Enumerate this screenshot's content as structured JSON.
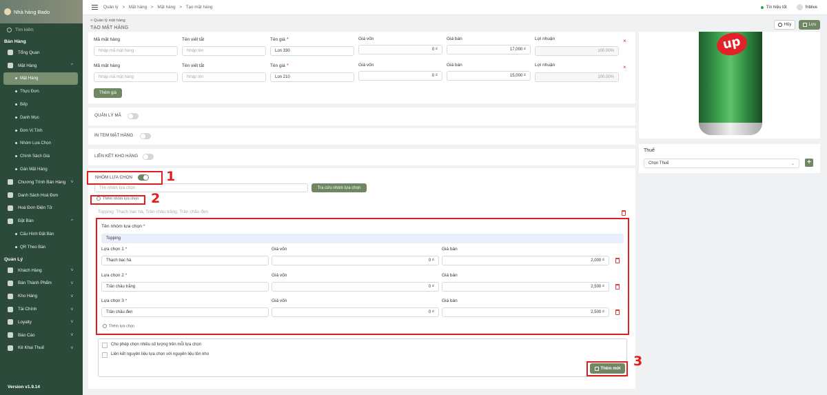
{
  "sidebar": {
    "brand": "Nhà hàng Bado",
    "search_placeholder": "Tìm kiếm",
    "section_sales": "Bán Hàng",
    "items_sales": [
      {
        "label": "Tổng Quan",
        "chev": ""
      },
      {
        "label": "Mặt Hàng",
        "chev": "^"
      }
    ],
    "sub_mathang": [
      "Mặt Hàng",
      "Thực Đơn",
      "Bếp",
      "Danh Mục",
      "Đơn Vị Tính",
      "Nhóm Lựa Chọn",
      "Chính Sách Giá",
      "Gán Mặt Hàng"
    ],
    "items_sales2": [
      {
        "label": "Chương Trình Bán Hàng",
        "chev": "v"
      },
      {
        "label": "Danh Sách Hoá Đơn",
        "chev": ""
      },
      {
        "label": "Hoá Đơn Điện Tử",
        "chev": ""
      },
      {
        "label": "Đặt Bàn",
        "chev": "^"
      }
    ],
    "sub_datban": [
      "Cấu Hình Đặt Bàn",
      "QR Theo Bàn"
    ],
    "section_manage": "Quản Lý",
    "items_manage": [
      {
        "label": "Khách Hàng",
        "chev": "v"
      },
      {
        "label": "Bán Thành Phẩm",
        "chev": "v"
      },
      {
        "label": "Kho Hàng",
        "chev": "v"
      },
      {
        "label": "Tài Chính",
        "chev": "v"
      },
      {
        "label": "Loyalty",
        "chev": "v"
      },
      {
        "label": "Báo Cáo",
        "chev": "v"
      },
      {
        "label": "Kê Khai Thuế",
        "chev": "v"
      }
    ],
    "version": "Version v1.9.14"
  },
  "topbar": {
    "crumbs": [
      "Quản lý",
      ">",
      "Mặt hàng",
      ">",
      "Mặt hàng",
      ">",
      "Tạo mặt hàng"
    ],
    "signal": "Tín hiệu tốt",
    "user": "fnblive"
  },
  "header": {
    "back": "< Quản lý mặt hàng",
    "title": "TẠO MẶT HÀNG",
    "cancel": "Hủy",
    "save": "Lưu"
  },
  "prices": {
    "headers": {
      "code": "Mã mặt hàng",
      "short": "Tên viết tắt",
      "price_name": "Tên giá",
      "cost": "Giá vốn",
      "sell": "Giá bán",
      "profit": "Lợi nhuận"
    },
    "placeholders": {
      "code": "Nhập mã mặt hàng",
      "short": "Nhập tên"
    },
    "rows": [
      {
        "name": "Lon 330",
        "cost": "0 ₫",
        "sell": "17,000 ₫",
        "profit": "100.00%"
      },
      {
        "name": "Lon 210",
        "cost": "0 ₫",
        "sell": "15,000 ₫",
        "profit": "100.00%"
      }
    ],
    "add_price": "Thêm giá",
    "remove_icon": "×"
  },
  "toggles": {
    "code_mgmt": "QUẢN LÝ MÃ",
    "print_label": "IN TEM MẶT HÀNG",
    "inventory_link": "LIÊN KẾT KHO HÀNG",
    "option_group": "NHÓM LỰA CHỌN"
  },
  "option_group": {
    "search_placeholder": "Tìm nhóm lựa chọn",
    "lookup_button": "Tra cứu nhóm lựa chọn",
    "add_group": "Thêm nhóm lựa chọn",
    "group_header": "Topping: Thạch bạc hà, Trân châu trắng, Trân châu đen",
    "group_name_label": "Tên nhóm lựa chọn",
    "group_name_value": "Topping",
    "cost_label": "Giá vốn",
    "sell_label": "Giá bán",
    "choices": [
      {
        "label": "Lựa chọn 1",
        "value": "Thạch bạc hà",
        "cost": "0 ₫",
        "sell": "2,000 ₫"
      },
      {
        "label": "Lựa chọn 2",
        "value": "Trân châu trắng",
        "cost": "0 ₫",
        "sell": "2,500 ₫"
      },
      {
        "label": "Lựa chọn 3",
        "value": "Trân châu đen",
        "cost": "0 ₫",
        "sell": "2,500 ₫"
      }
    ],
    "add_choice": "Thêm lựa chọn",
    "allow_multi": "Cho phép chọn nhiều số lượng trên mỗi lựa chọn",
    "link_material": "Liên kết nguyên liệu lựa chọn với nguyên liệu tồn kho",
    "add_new": "Thêm mới"
  },
  "callouts": [
    "1",
    "2",
    "3"
  ],
  "tax": {
    "label": "Thuế",
    "select": "Chọn Thuế",
    "add": "+"
  },
  "product_image": {
    "logo_text": "up"
  },
  "colors": {
    "accent": "#6f8762",
    "sidebar": "#2b4a3a",
    "highlight": "#e01e1e"
  }
}
